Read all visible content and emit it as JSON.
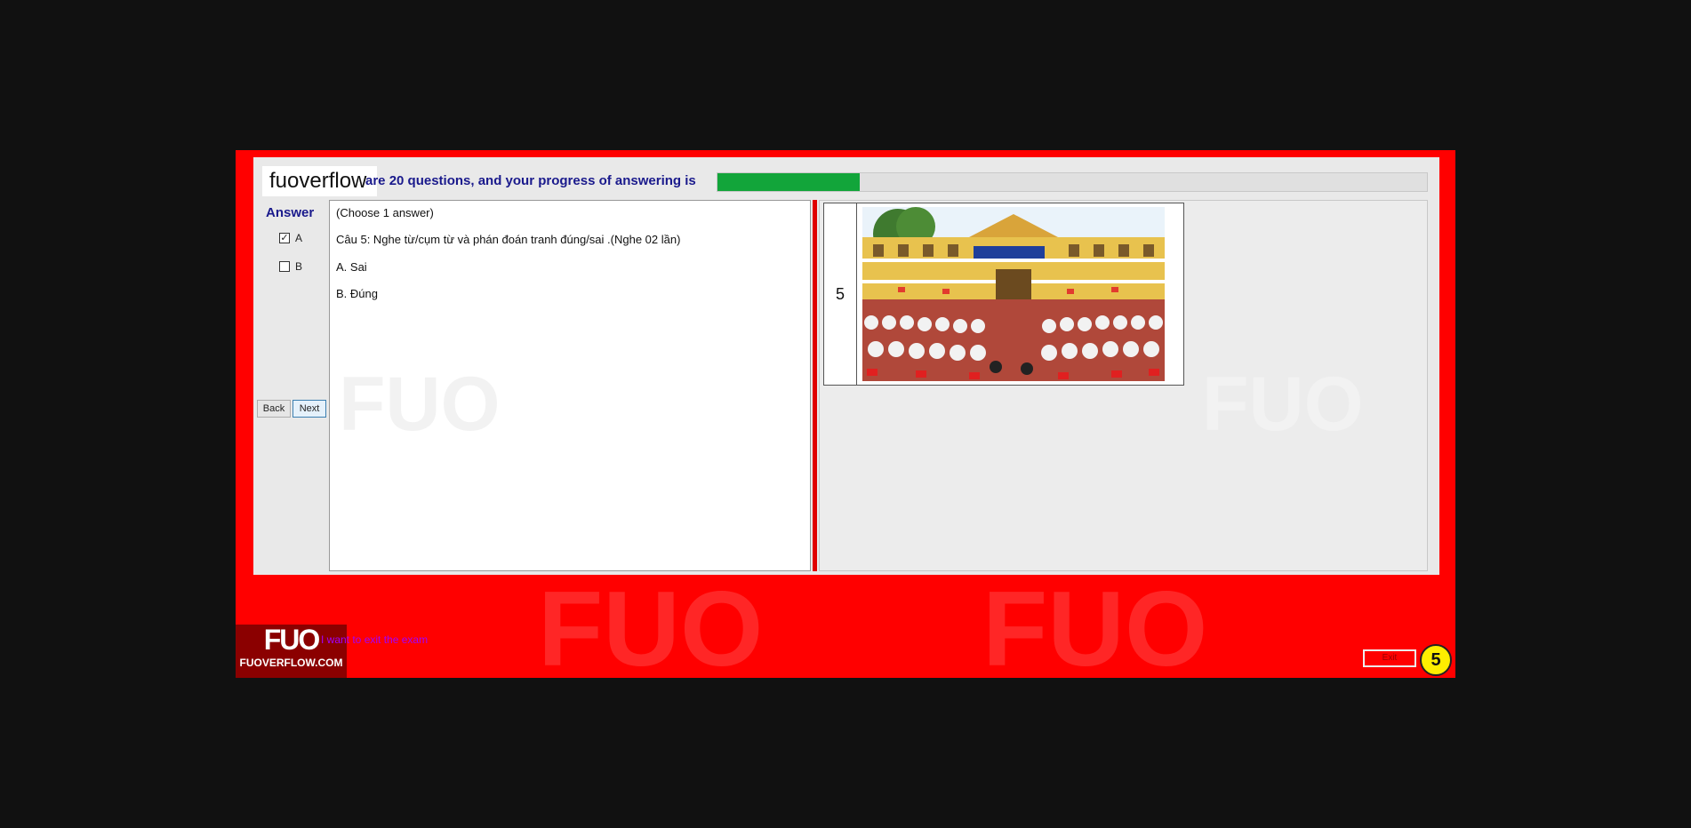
{
  "app": {
    "brand": "fuoverflow",
    "progress_text": "are 20 questions, and your progress of answering is",
    "progress_fraction": 0.2
  },
  "answer_panel": {
    "title": "Answer",
    "options": [
      {
        "label": "A",
        "checked": true
      },
      {
        "label": "B",
        "checked": false
      }
    ],
    "back_label": "Back",
    "next_label": "Next"
  },
  "question": {
    "instruction": "(Choose 1 answer)",
    "text": "Câu 5: Nghe từ/cụm từ và phán đoán tranh đúng/sai .(Nghe 02 lần)",
    "choices": [
      "A.  Sai",
      "B.  Đúng"
    ]
  },
  "image_table": {
    "number": "5",
    "image_alt": "school yard with students"
  },
  "footer": {
    "link_text": "I want to exit the exam",
    "logo_top": "FUO",
    "logo_bottom": "FUOVERFLOW.COM",
    "exit_label": "Exit",
    "badge_number": "5"
  },
  "colors": {
    "frame": "#ff0000",
    "progress": "#12a53a",
    "title_blue": "#1a1a8c"
  }
}
